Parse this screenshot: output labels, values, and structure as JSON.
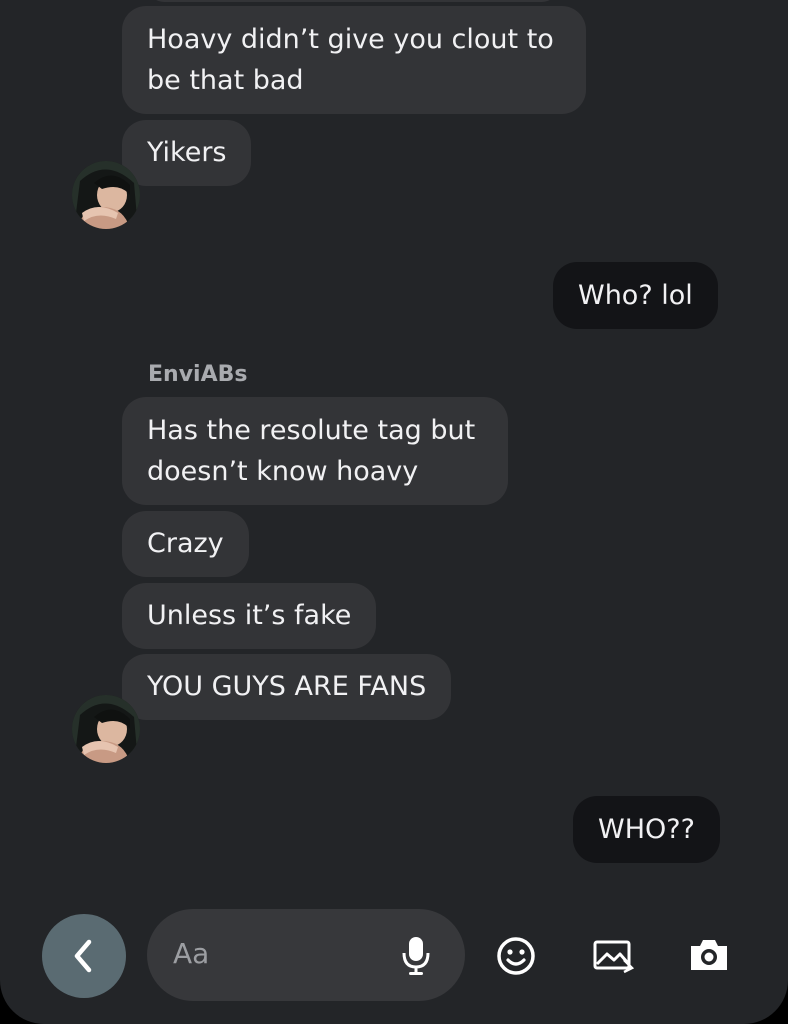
{
  "conversation": {
    "messages": [
      {
        "direction": "incoming",
        "lines": [
          "Hoavy didn’t give you clout to",
          "be that bad"
        ]
      },
      {
        "direction": "incoming",
        "lines": [
          "Yikers"
        ]
      },
      {
        "direction": "outgoing",
        "lines": [
          "Who? lol"
        ]
      },
      {
        "direction": "incoming",
        "sender": "EnviABs",
        "lines": [
          "Has the resolute tag but",
          "doesn’t know hoavy"
        ]
      },
      {
        "direction": "incoming",
        "lines": [
          "Crazy"
        ]
      },
      {
        "direction": "incoming",
        "lines": [
          "Unless it’s fake"
        ]
      },
      {
        "direction": "incoming",
        "lines": [
          "YOU GUYS ARE FANS"
        ]
      },
      {
        "direction": "outgoing",
        "lines": [
          "WHO??"
        ]
      }
    ]
  },
  "composer": {
    "placeholder": "Aa",
    "value": "",
    "icons": {
      "back": "chevron-left-icon",
      "mic": "microphone-icon",
      "emoji": "emoji-icon",
      "image": "image-icon",
      "camera": "camera-icon"
    }
  },
  "colors": {
    "background": "#232528",
    "incoming_bubble": "#333437",
    "outgoing_bubble": "#131417",
    "text": "#f1f1f3",
    "sender_name": "#a9abaf",
    "back_button": "#5a6b72"
  }
}
